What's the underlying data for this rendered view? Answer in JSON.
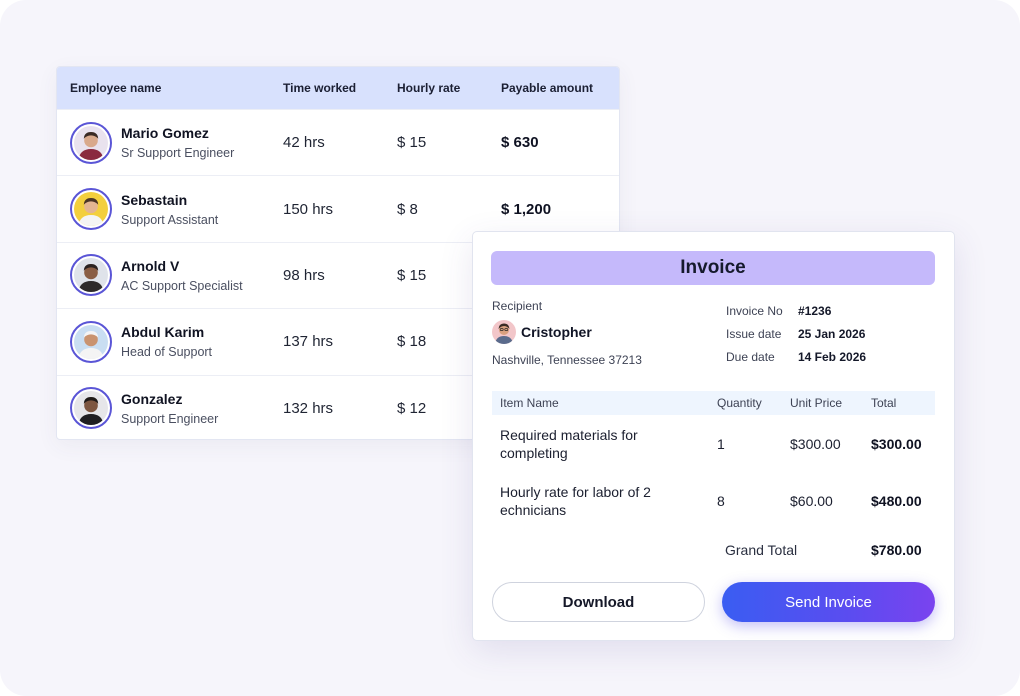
{
  "employees_table": {
    "headers": {
      "name": "Employee name",
      "time": "Time worked",
      "rate": "Hourly rate",
      "amount": "Payable amount"
    },
    "rows": [
      {
        "name": "Mario Gomez",
        "role": "Sr Support Engineer",
        "time": "42 hrs",
        "rate": "$ 15",
        "amount": "$ 630",
        "avatar_bg": "#e9e2ee",
        "skin": "#d9a98c",
        "hair": "#3a2a24",
        "shirt": "#8a2a3f"
      },
      {
        "name": "Sebastain",
        "role": "Support Assistant",
        "time": "150 hrs",
        "rate": "$ 8",
        "amount": "$ 1,200",
        "avatar_bg": "#f3cf3d",
        "skin": "#e3b592",
        "hair": "#4a3526",
        "shirt": "#f4f4f4"
      },
      {
        "name": "Arnold V",
        "role": "AC Support Specialist",
        "time": "98 hrs",
        "rate": "$ 15",
        "amount": "",
        "avatar_bg": "#dfe3ea",
        "skin": "#8a5e45",
        "hair": "#2a2220",
        "shirt": "#2d2a2a"
      },
      {
        "name": "Abdul Karim",
        "role": "Head of Support",
        "time": "137 hrs",
        "rate": "$ 18",
        "amount": "",
        "avatar_bg": "#c9def2",
        "skin": "#c9936f",
        "hair": "#f4f4f4",
        "shirt": "#f4f4f4"
      },
      {
        "name": "Gonzalez",
        "role": "Support Engineer",
        "time": "132 hrs",
        "rate": "$ 12",
        "amount": "",
        "avatar_bg": "#e6e6e9",
        "skin": "#7d5640",
        "hair": "#1f1a18",
        "shirt": "#1f1f22"
      }
    ]
  },
  "invoice": {
    "title": "Invoice",
    "recipient_label": "Recipient",
    "recipient_name": "Cristopher",
    "recipient_address": "Nashville, Tennessee 37213",
    "meta": {
      "invoice_no_label": "Invoice No",
      "invoice_no": "#1236",
      "issue_date_label": "Issue date",
      "issue_date": "25 Jan 2026",
      "due_date_label": "Due date",
      "due_date": "14 Feb 2026"
    },
    "columns": {
      "item": "Item Name",
      "qty": "Quantity",
      "unit": "Unit Price",
      "total": "Total"
    },
    "items": [
      {
        "name": "Required materials for completing",
        "qty": "1",
        "unit": "$300.00",
        "total": "$300.00"
      },
      {
        "name": "Hourly rate for labor of 2 echnicians",
        "qty": "8",
        "unit": "$60.00",
        "total": "$480.00"
      }
    ],
    "grand_total_label": "Grand Total",
    "grand_total": "$780.00",
    "buttons": {
      "download": "Download",
      "send": "Send Invoice"
    }
  },
  "colors": {
    "table_header_bg": "#d8e1fd",
    "invoice_title_bg": "#c5b9fb",
    "items_header_bg": "#eef5fe",
    "send_gradient_start": "#3a5df2",
    "send_gradient_end": "#7a43ef",
    "avatar_ring": "#5a55d6"
  }
}
